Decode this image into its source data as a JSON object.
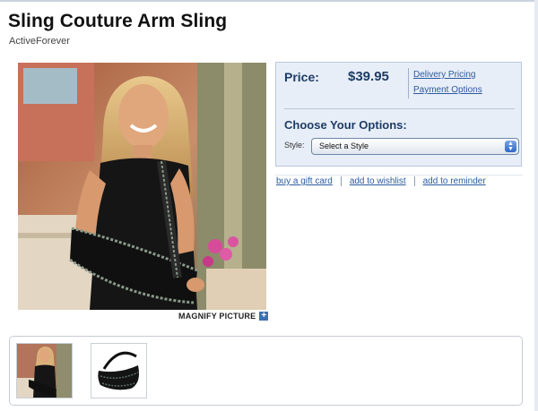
{
  "product": {
    "title": "Sling Couture Arm Sling",
    "brand": "ActiveForever"
  },
  "image": {
    "magnify_label": "MAGNIFY PICTURE",
    "magnify_icon": "plus-icon"
  },
  "buybox": {
    "price_label": "Price:",
    "price_value": "$39.95",
    "delivery_link": "Delivery Pricing",
    "payment_link": "Payment Options",
    "choose_label": "Choose Your Options:",
    "style_label": "Style:",
    "style_select_value": "Select a Style"
  },
  "actions": {
    "gift_card": "buy a gift card",
    "wishlist": "add to wishlist",
    "reminder": "add to reminder"
  },
  "thumbnails": [
    {
      "name": "model-wearing-sling"
    },
    {
      "name": "black-sling-product"
    }
  ],
  "colors": {
    "link": "#2c5aa0",
    "buybox_bg": "#e8eef7",
    "heading_blue": "#1d3c66"
  }
}
